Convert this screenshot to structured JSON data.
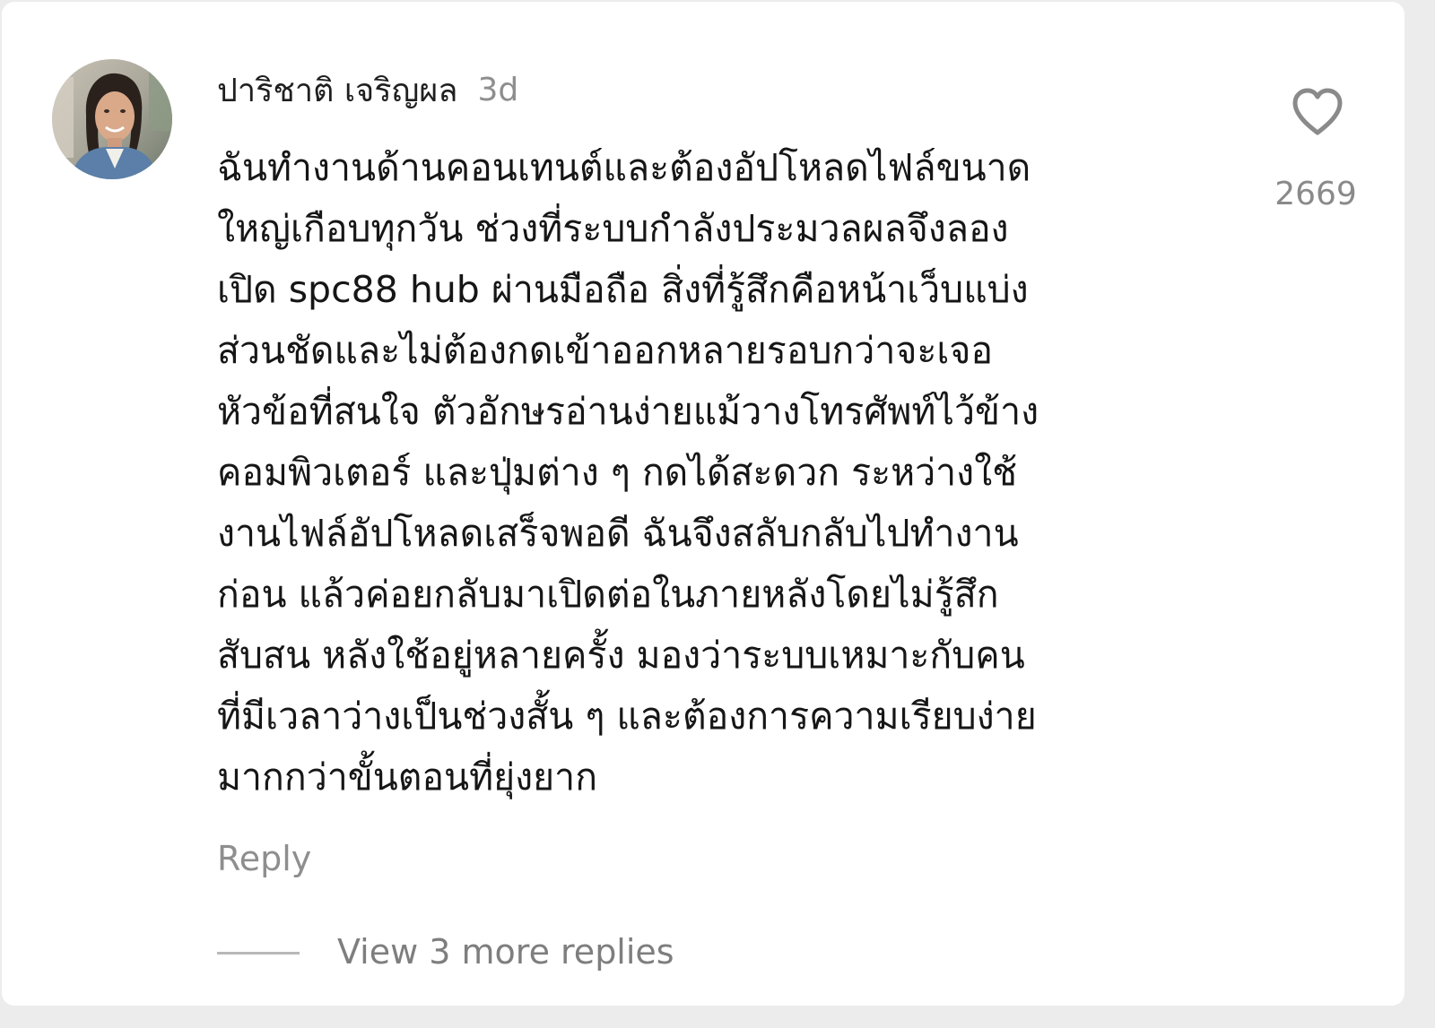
{
  "comment": {
    "author": "ปาริชาติ เจริญผล",
    "time": "3d",
    "text": "ฉันทำงานด้านคอนเทนต์และต้องอัปโหลดไฟล์ขนาด\nใหญ่เกือบทุกวัน ช่วงที่ระบบกำลังประมวลผลจึงลอง\nเปิด spc88 hub ผ่านมือถือ สิ่งที่รู้สึกคือหน้าเว็บแบ่ง\nส่วนชัดและไม่ต้องกดเข้าออกหลายรอบกว่าจะเจอ\nหัวข้อที่สนใจ ตัวอักษรอ่านง่ายแม้วางโทรศัพท์ไว้ข้าง\nคอมพิวเตอร์ และปุ่มต่าง ๆ กดได้สะดวก ระหว่างใช้\nงานไฟล์อัปโหลดเสร็จพอดี ฉันจึงสลับกลับไปทำงาน\nก่อน แล้วค่อยกลับมาเปิดต่อในภายหลังโดยไม่รู้สึก\nสับสน หลังใช้อยู่หลายครั้ง มองว่าระบบเหมาะกับคน\nที่มีเวลาว่างเป็นช่วงสั้น ๆ และต้องการความเรียบง่าย\nมากกว่าขั้นตอนที่ยุ่งยาก",
    "like_count": "2669",
    "reply_label": "Reply",
    "view_more_label": "View 3 more replies"
  },
  "icons": {
    "like": "heart-outline-icon",
    "avatar": "user-avatar"
  },
  "colors": {
    "background": "#ffffff",
    "text_primary": "#161616",
    "text_secondary": "#8e8e8e"
  }
}
